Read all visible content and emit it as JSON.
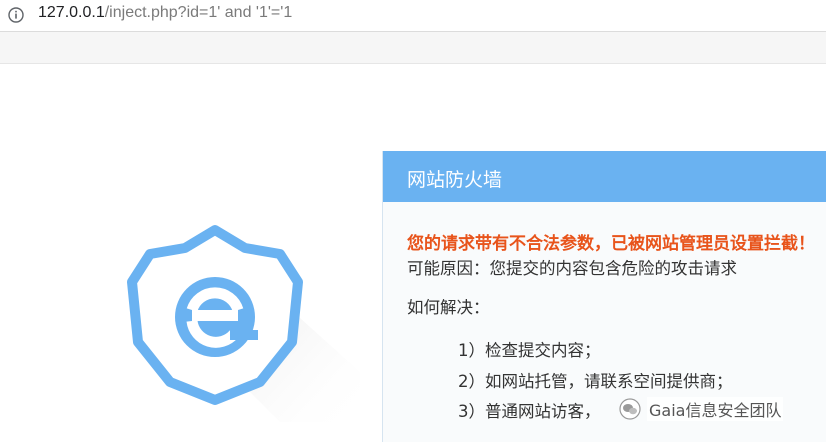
{
  "browser": {
    "url_host": "127.0.0.1",
    "url_path": "/inject.php?id=1' and '1'='1"
  },
  "waf": {
    "title": "网站防火墙",
    "warning": "您的请求带有不合法参数，已被网站管理员设置拦截！",
    "reason": "可能原因：您提交的内容包含危险的攻击请求",
    "how_to": "如何解决：",
    "steps": [
      "1）检查提交内容；",
      "2）如网站托管，请联系空间提供商；",
      "3）普通网站访客，"
    ]
  },
  "watermark": {
    "text": "Gaia信息安全团队"
  },
  "colors": {
    "header_blue": "#6ab2f1",
    "warning_orange": "#e8541b",
    "shield_blue": "#6ab2f1"
  }
}
